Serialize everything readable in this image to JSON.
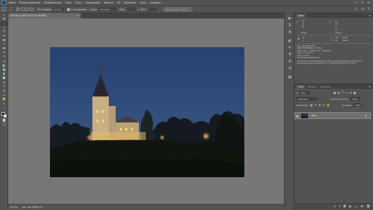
{
  "app": {
    "logo": "Ps"
  },
  "menu": [
    "Файл",
    "Редактирование",
    "Изображение",
    "Слои",
    "Текст",
    "Выделение",
    "Фильтр",
    "3D",
    "Просмотр",
    "Окно",
    "Справка"
  ],
  "window_controls": {
    "minimize": "—",
    "maximize": "☐",
    "close": "✕"
  },
  "options_bar": {
    "feather_label": "Растушевка:",
    "feather_value": "0 пикс.",
    "smoothing_label": "Сглаживание",
    "style_label": "Стиль:",
    "style_value": "Обычный",
    "width_label": "Шир.:",
    "height_label": "Выс.:",
    "select_mask_label": "Выделение и маска..."
  },
  "document": {
    "tab_title": "DSC08121.NEF @ 16,7% (RGB/8)",
    "zoom": "16,67%",
    "doc_info": "Док: 68,7M/68,7M"
  },
  "info_panel": {
    "tab": "Инфо",
    "r": "R:",
    "g": "G:",
    "b": "B:",
    "c": "C:",
    "m": "M:",
    "y": "Y:",
    "k": "K:",
    "bit_left": "8-бит",
    "bit_right": "8-бит",
    "x": "X:",
    "y_coord": "Y:",
    "w": "Ш:",
    "h": "В:",
    "x_val": "3938",
    "w_val": "3808",
    "doc_lines": [
      "Док: 68,7M/68,7M",
      "sRGB IEC61966-2.1 (8bpc)",
      "3000 пикс. x 4000 пикс. (300 ppi)",
      "2,64 см x 9,2 см",
      "Порт. 1/0,5 с",
      "Подсказки выделения"
    ],
    "hint_lines": [
      "Установите в изображении область или перетащите ее мышью.",
      "Дополнительные параметры: с клавишами Shift, Alt и Ctrl."
    ]
  },
  "layers_panel": {
    "tabs": [
      "Слои",
      "Каналы",
      "Контуры"
    ],
    "filter_label": "Вид",
    "blend_mode": "Обычные",
    "opacity_label": "Непрозрачность:",
    "opacity_value": "100%",
    "lock_label": "Закрепить:",
    "fill_label": "Заливка:",
    "fill_value": "100%",
    "layer_name": "Фон"
  }
}
